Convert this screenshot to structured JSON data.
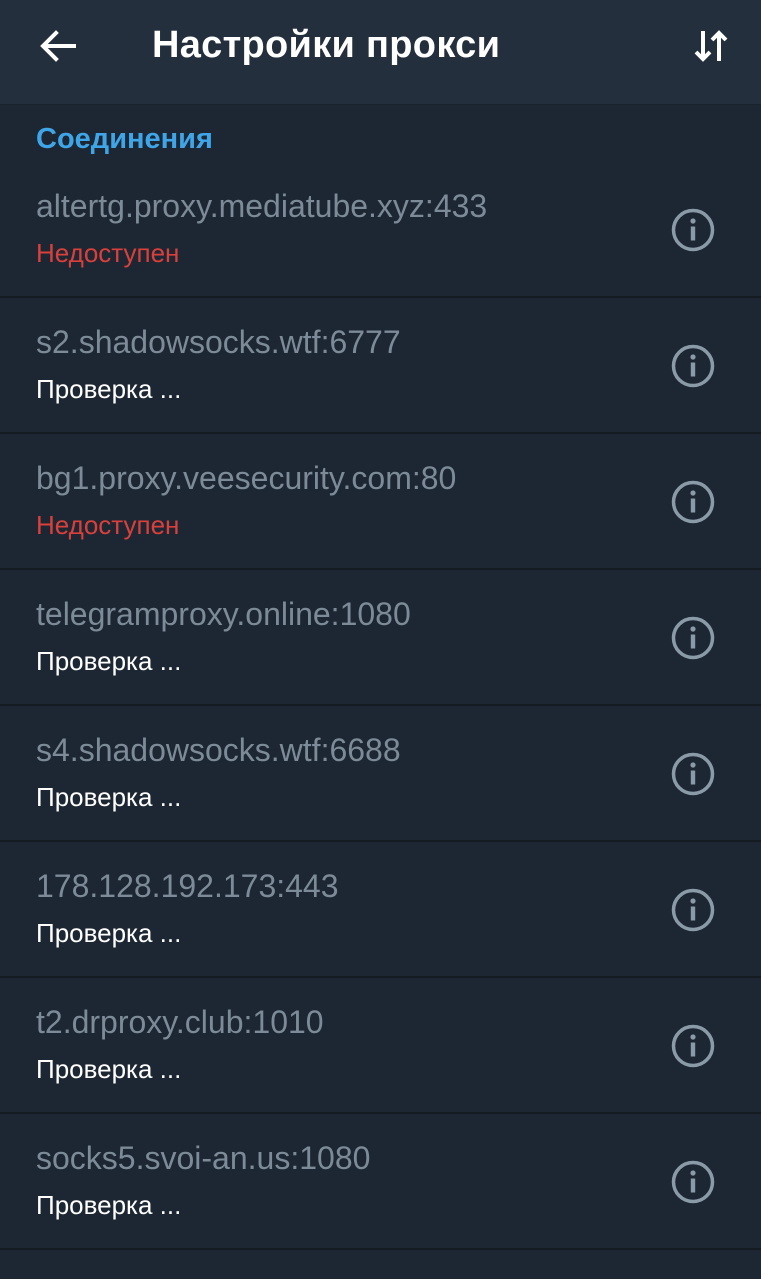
{
  "header": {
    "title": "Настройки прокси",
    "back_icon": "arrow-left-icon",
    "sort_icon": "sort-icon"
  },
  "section": {
    "title": "Соединения"
  },
  "colors": {
    "accent": "#3ea6e8",
    "unavailable": "#d9403c",
    "background": "#1d2733",
    "appbar": "#232f3c"
  },
  "proxies": [
    {
      "host": "altertg.proxy.mediatube.xyz:433",
      "status": "Недоступен",
      "state": "unavailable"
    },
    {
      "host": "s2.shadowsocks.wtf:6777",
      "status": "Проверка ...",
      "state": "checking"
    },
    {
      "host": "bg1.proxy.veesecurity.com:80",
      "status": "Недоступен",
      "state": "unavailable"
    },
    {
      "host": "telegramproxy.online:1080",
      "status": "Проверка ...",
      "state": "checking"
    },
    {
      "host": "s4.shadowsocks.wtf:6688",
      "status": "Проверка ...",
      "state": "checking"
    },
    {
      "host": "178.128.192.173:443",
      "status": "Проверка ...",
      "state": "checking"
    },
    {
      "host": "t2.drproxy.club:1010",
      "status": "Проверка ...",
      "state": "checking"
    },
    {
      "host": "socks5.svoi-an.us:1080",
      "status": "Проверка ...",
      "state": "checking"
    }
  ]
}
